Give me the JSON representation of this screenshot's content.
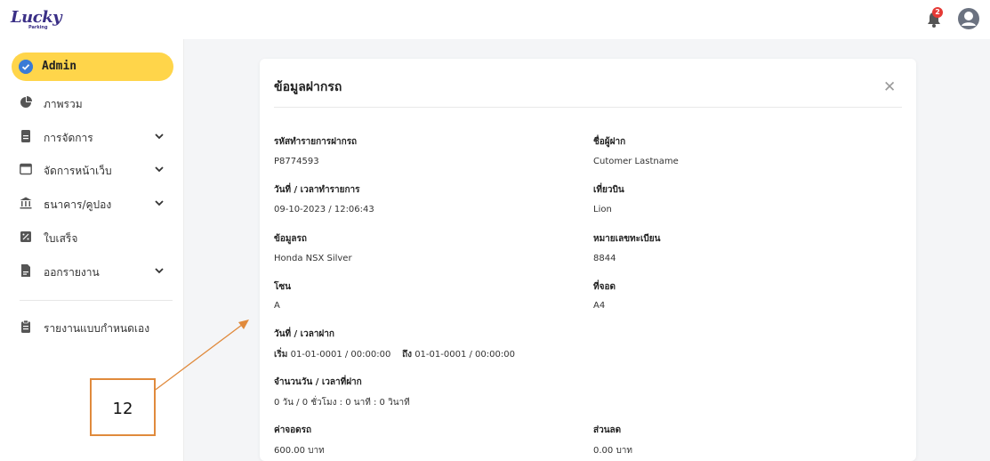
{
  "brand": {
    "name": "Lucky",
    "sub": "Parking"
  },
  "header": {
    "notification_count": "2"
  },
  "sidebar": {
    "admin_label": "Admin",
    "items": [
      {
        "label": "ภาพรวม",
        "icon": "pie-chart-icon",
        "has_chevron": false
      },
      {
        "label": "การจัดการ",
        "icon": "document-icon",
        "has_chevron": true
      },
      {
        "label": "จัดการหน้าเว็บ",
        "icon": "window-icon",
        "has_chevron": true
      },
      {
        "label": "ธนาคาร/คูปอง",
        "icon": "bank-icon",
        "has_chevron": true
      },
      {
        "label": "ใบเสร็จ",
        "icon": "receipt-icon",
        "has_chevron": false
      },
      {
        "label": "ออกรายงาน",
        "icon": "report-file-icon",
        "has_chevron": true
      }
    ],
    "custom_report": {
      "label": "รายงานแบบกำหนดเอง",
      "icon": "clipboard-icon"
    }
  },
  "modal": {
    "title": "ข้อมูลฝากรถ",
    "fields": {
      "transaction_id_label": "รหัสทำรายการฝากรถ",
      "transaction_id": "P8774593",
      "depositor_label": "ชื่อผู้ฝาก",
      "depositor": "Cutomer Lastname",
      "datetime_label": "วันที่ / เวลาทำรายการ",
      "datetime": "09-10-2023 / 12:06:43",
      "flight_label": "เที่ยวบิน",
      "flight": "Lion",
      "car_label": "ข้อมูลรถ",
      "car": "Honda NSX Silver",
      "plate_label": "หมายเลขทะเบียน",
      "plate": "8844",
      "zone_label": "โซน",
      "zone": "A",
      "spot_label": "ที่จอด",
      "spot": "A4",
      "deposit_period_label": "วันที่ / เวลาฝาก",
      "start_word": "เริ่ม",
      "start_value": "01-01-0001 / 00:00:00",
      "end_word": "ถึง",
      "end_value": "01-01-0001 / 00:00:00",
      "duration_label": "จำนวนวัน / เวลาที่ฝาก",
      "duration": "0 วัน / 0 ชั่วโมง : 0 นาที : 0 วินาที",
      "fee_label": "ค่าจอดรถ",
      "fee": "600.00 บาท",
      "discount_label": "ส่วนลด",
      "discount": "0.00 บาท"
    }
  },
  "annotation": {
    "number": "12",
    "color": "#e08a3c"
  },
  "colors": {
    "accent": "#ffd54a",
    "brand": "#3a2f86",
    "badge": "#e53935"
  }
}
